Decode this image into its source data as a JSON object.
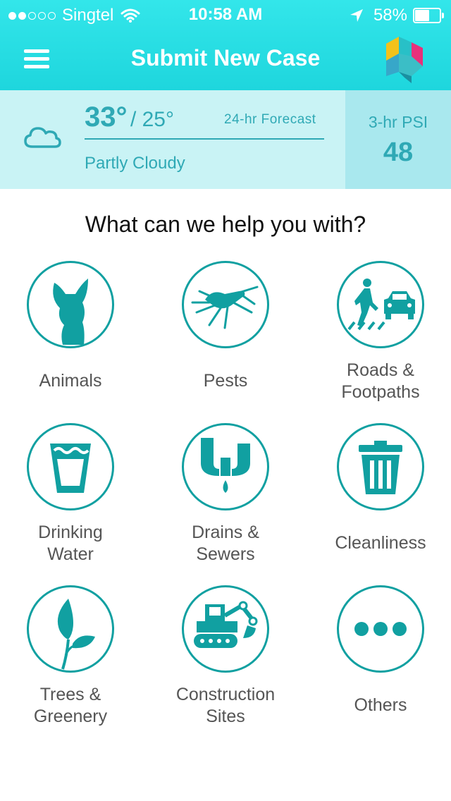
{
  "status_bar": {
    "carrier": "Singtel",
    "time": "10:58 AM",
    "battery": "58%",
    "battery_level": 0.58
  },
  "nav": {
    "title": "Submit New Case",
    "menu_icon": "hamburger-menu-icon",
    "logo": "app-logo"
  },
  "weather": {
    "high": "33°",
    "low": "/ 25°",
    "forecast_label": "24-hr Forecast",
    "condition": "Partly Cloudy",
    "psi_label": "3-hr PSI",
    "psi_value": "48",
    "icon": "cloud-icon"
  },
  "main": {
    "question": "What can we help you with?",
    "categories": [
      {
        "line1": "Animals",
        "line2": "",
        "icon": "animals-icon"
      },
      {
        "line1": "Pests",
        "line2": "",
        "icon": "pests-icon"
      },
      {
        "line1": "Roads &",
        "line2": "Footpaths",
        "icon": "roads-footpaths-icon"
      },
      {
        "line1": "Drinking",
        "line2": "Water",
        "icon": "drinking-water-icon"
      },
      {
        "line1": "Drains &",
        "line2": "Sewers",
        "icon": "drains-sewers-icon"
      },
      {
        "line1": "Cleanliness",
        "line2": "",
        "icon": "cleanliness-icon"
      },
      {
        "line1": "Trees &",
        "line2": "Greenery",
        "icon": "trees-greenery-icon"
      },
      {
        "line1": "Construction",
        "line2": "Sites",
        "icon": "construction-sites-icon"
      },
      {
        "line1": "Others",
        "line2": "",
        "icon": "others-icon"
      }
    ]
  },
  "colors": {
    "header": "#1ed6dd",
    "weather_bg": "#c9f3f5",
    "psi_bg": "#a9e8ee",
    "accent": "#11a0a1",
    "weather_text": "#2fa9b5"
  }
}
